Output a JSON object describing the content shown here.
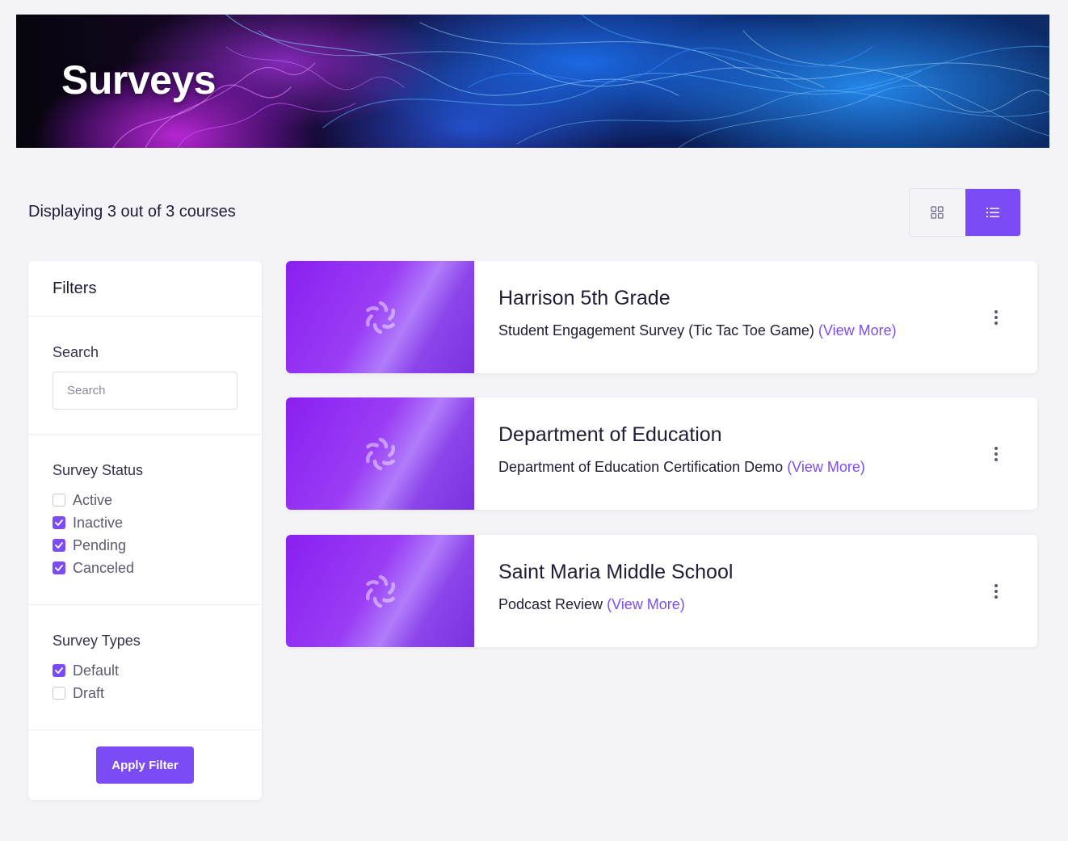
{
  "banner": {
    "title": "Surveys"
  },
  "summary": {
    "count_text": "Displaying 3 out of 3 courses"
  },
  "view_toggle": {
    "options": [
      "grid-view",
      "list-view"
    ],
    "active": "list-view"
  },
  "filters": {
    "title": "Filters",
    "search": {
      "label": "Search",
      "placeholder": "Search",
      "value": ""
    },
    "survey_status": {
      "label": "Survey Status",
      "options": [
        {
          "label": "Active",
          "checked": false
        },
        {
          "label": "Inactive",
          "checked": true
        },
        {
          "label": "Pending",
          "checked": true
        },
        {
          "label": "Canceled",
          "checked": true
        }
      ]
    },
    "survey_types": {
      "label": "Survey Types",
      "options": [
        {
          "label": "Default",
          "checked": true
        },
        {
          "label": "Draft",
          "checked": false
        }
      ]
    },
    "apply_label": "Apply Filter"
  },
  "surveys": [
    {
      "title": "Harrison 5th Grade",
      "description": "Student Engagement Survey (Tic Tac Toe Game)",
      "link": "(View More)"
    },
    {
      "title": "Department of Education",
      "description": "Department of Education Certification Demo",
      "link": "(View More)"
    },
    {
      "title": "Saint Maria Middle School",
      "description": "Podcast Review",
      "link": "(View More)"
    }
  ],
  "colors": {
    "accent": "#7b4cf5",
    "text": "#1e1d34",
    "background": "#f4f4f8"
  },
  "icons": {
    "grid": "grid-icon",
    "list": "list-icon",
    "thumbnail": "spinner-icon",
    "more": "more-vertical-icon",
    "check": "check-icon"
  }
}
